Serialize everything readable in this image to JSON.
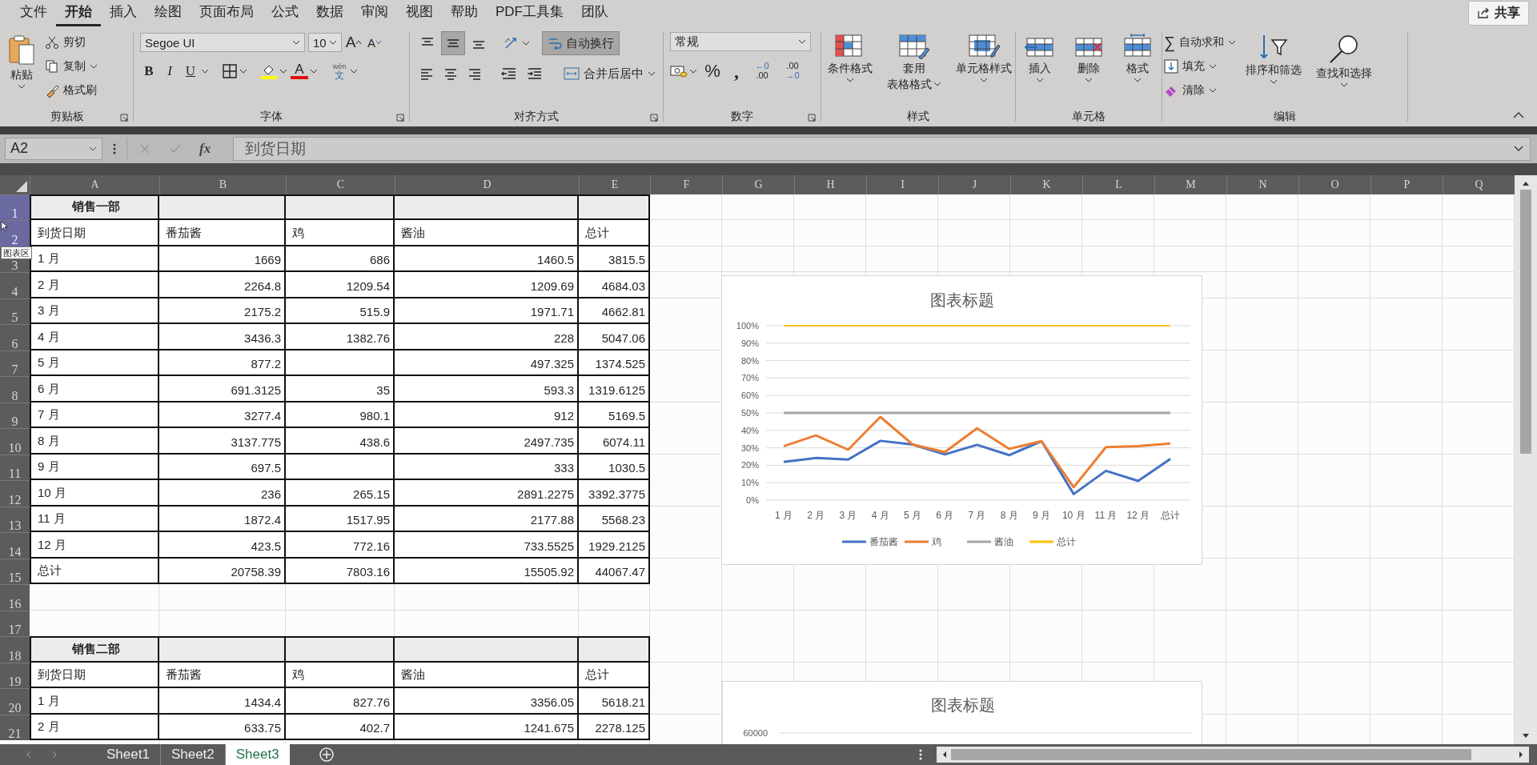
{
  "menu": {
    "tabs": [
      {
        "label": "文件",
        "selected": false
      },
      {
        "label": "开始",
        "selected": true
      },
      {
        "label": "插入",
        "selected": false
      },
      {
        "label": "绘图",
        "selected": false
      },
      {
        "label": "页面布局",
        "selected": false
      },
      {
        "label": "公式",
        "selected": false
      },
      {
        "label": "数据",
        "selected": false
      },
      {
        "label": "审阅",
        "selected": false
      },
      {
        "label": "视图",
        "selected": false
      },
      {
        "label": "帮助",
        "selected": false
      },
      {
        "label": "PDF工具集",
        "selected": false
      },
      {
        "label": "团队",
        "selected": false
      }
    ],
    "share": "共享"
  },
  "ribbon": {
    "clipboard": {
      "label": "剪贴板",
      "paste": "粘贴",
      "cut": "剪切",
      "copy": "复制",
      "format_painter": "格式刷"
    },
    "font": {
      "label": "字体",
      "family": "Segoe UI",
      "size": "10",
      "grow": "A",
      "shrink": "A",
      "styles": [
        {
          "kind": "bold",
          "label": "B"
        },
        {
          "kind": "italic",
          "label": "I"
        },
        {
          "kind": "underline",
          "label": "U"
        }
      ],
      "font_color": "A",
      "phonetic_top": "wén",
      "phonetic_char": "文"
    },
    "alignment": {
      "label": "对齐方式",
      "vertical": [
        {
          "kind": "top",
          "selected": false
        },
        {
          "kind": "middle",
          "selected": true
        },
        {
          "kind": "bottom",
          "selected": false
        }
      ],
      "wrap": {
        "label": "自动换行",
        "selected": true
      },
      "merge": "合并后居中"
    },
    "number": {
      "label": "数字",
      "format": "常规",
      "percent": "%",
      "comma": ",",
      "decimals": [
        {
          "kind": "increase",
          "top": "←0",
          "bottom": ".00"
        },
        {
          "kind": "decrease",
          "top": ".00",
          "bottom": "→0"
        }
      ]
    },
    "styles": {
      "label": "样式",
      "buttons": [
        {
          "kind": "conditional",
          "lines": [
            "条件格式"
          ]
        },
        {
          "kind": "table",
          "lines": [
            "套用",
            "表格格式"
          ]
        },
        {
          "kind": "cell",
          "lines": [
            "单元格样式"
          ]
        }
      ]
    },
    "cells": {
      "label": "单元格",
      "buttons": [
        {
          "kind": "insert",
          "label": "插入"
        },
        {
          "kind": "delete",
          "label": "删除"
        },
        {
          "kind": "format",
          "label": "格式"
        }
      ]
    },
    "editing": {
      "label": "编辑",
      "autosum_symbol": "∑",
      "autosum": "自动求和",
      "fill": "填充",
      "clear": "清除",
      "sort": "排序和筛选",
      "find": "查找和选择"
    }
  },
  "formula_bar": {
    "name_box": "A2",
    "fx": "fx",
    "value": "到货日期"
  },
  "sheet": {
    "columns": [
      "A",
      "B",
      "C",
      "D",
      "E",
      "F",
      "G",
      "H",
      "I",
      "J",
      "K",
      "L",
      "M",
      "N",
      "O",
      "P",
      "Q"
    ],
    "rows": [
      {
        "number": "1",
        "selected": true,
        "kind": "title",
        "cells": [
          "销售一部",
          null,
          null,
          null,
          null
        ]
      },
      {
        "number": "2",
        "selected": true,
        "kind": "header",
        "cells": [
          "到货日期",
          "番茄酱",
          "鸡",
          "酱油",
          "总计"
        ]
      },
      {
        "number": "3",
        "selected": false,
        "kind": "data",
        "cells": [
          "1 月",
          "1669",
          "686",
          "1460.5",
          "3815.5"
        ]
      },
      {
        "number": "4",
        "selected": false,
        "kind": "data",
        "cells": [
          "2 月",
          "2264.8",
          "1209.54",
          "1209.69",
          "4684.03"
        ]
      },
      {
        "number": "5",
        "selected": false,
        "kind": "data",
        "cells": [
          "3 月",
          "2175.2",
          "515.9",
          "1971.71",
          "4662.81"
        ]
      },
      {
        "number": "6",
        "selected": false,
        "kind": "data",
        "cells": [
          "4 月",
          "3436.3",
          "1382.76",
          "228",
          "5047.06"
        ]
      },
      {
        "number": "7",
        "selected": false,
        "kind": "data",
        "cells": [
          "5 月",
          "877.2",
          null,
          "497.325",
          "1374.525"
        ]
      },
      {
        "number": "8",
        "selected": false,
        "kind": "data",
        "cells": [
          "6 月",
          "691.3125",
          "35",
          "593.3",
          "1319.6125"
        ]
      },
      {
        "number": "9",
        "selected": false,
        "kind": "data",
        "cells": [
          "7 月",
          "3277.4",
          "980.1",
          "912",
          "5169.5"
        ]
      },
      {
        "number": "10",
        "selected": false,
        "kind": "data",
        "cells": [
          "8 月",
          "3137.775",
          "438.6",
          "2497.735",
          "6074.11"
        ]
      },
      {
        "number": "11",
        "selected": false,
        "kind": "data",
        "cells": [
          "9 月",
          "697.5",
          null,
          "333",
          "1030.5"
        ]
      },
      {
        "number": "12",
        "selected": false,
        "kind": "data",
        "cells": [
          "10 月",
          "236",
          "265.15",
          "2891.2275",
          "3392.3775"
        ]
      },
      {
        "number": "13",
        "selected": false,
        "kind": "data",
        "cells": [
          "11 月",
          "1872.4",
          "1517.95",
          "2177.88",
          "5568.23"
        ]
      },
      {
        "number": "14",
        "selected": false,
        "kind": "data",
        "cells": [
          "12 月",
          "423.5",
          "772.16",
          "733.5525",
          "1929.2125"
        ]
      },
      {
        "number": "15",
        "selected": false,
        "kind": "data",
        "cells": [
          "总计",
          "20758.39",
          "7803.16",
          "15505.92",
          "44067.47"
        ]
      },
      {
        "number": "16",
        "selected": false,
        "kind": "empty"
      },
      {
        "number": "17",
        "selected": false,
        "kind": "empty"
      },
      {
        "number": "18",
        "selected": false,
        "kind": "title",
        "cells": [
          "销售二部",
          null,
          null,
          null,
          null
        ]
      },
      {
        "number": "19",
        "selected": false,
        "kind": "header",
        "cells": [
          "到货日期",
          "番茄酱",
          "鸡",
          "酱油",
          "总计"
        ]
      },
      {
        "number": "20",
        "selected": false,
        "kind": "data",
        "cells": [
          "1 月",
          "1434.4",
          "827.76",
          "3356.05",
          "5618.21"
        ]
      },
      {
        "number": "21",
        "selected": false,
        "kind": "data",
        "cells": [
          "2 月",
          "633.75",
          "402.7",
          "1241.675",
          "2278.125"
        ]
      }
    ]
  },
  "tooltip": "图表区",
  "charts": [
    {
      "chart_data": {
        "type": "line",
        "title": "图表标题",
        "grid": true,
        "legend": true,
        "categories": [
          "1 月",
          "2 月",
          "3 月",
          "4 月",
          "5 月",
          "6 月",
          "7 月",
          "8 月",
          "9 月",
          "10 月",
          "11 月",
          "12 月",
          "总计"
        ],
        "ylim": [
          0,
          100
        ],
        "yticks": [
          {
            "value": 0,
            "label": "0%"
          },
          {
            "value": 10,
            "label": "10%"
          },
          {
            "value": 20,
            "label": "20%"
          },
          {
            "value": 30,
            "label": "30%"
          },
          {
            "value": 40,
            "label": "40%"
          },
          {
            "value": 50,
            "label": "50%"
          },
          {
            "value": 60,
            "label": "60%"
          },
          {
            "value": 70,
            "label": "70%"
          },
          {
            "value": 80,
            "label": "80%"
          },
          {
            "value": 90,
            "label": "90%"
          },
          {
            "value": 100,
            "label": "100%"
          }
        ],
        "series": [
          {
            "name": "番茄酱",
            "color": "#4472c4",
            "values": [
              21.9,
              24.2,
              23.3,
              34.0,
              31.9,
              26.2,
              31.7,
              25.8,
              33.8,
              3.5,
              16.8,
              11.0,
              23.6
            ]
          },
          {
            "name": "鸡",
            "color": "#ed7d31",
            "values": [
              30.9,
              37.1,
              28.9,
              47.7,
              31.9,
              27.5,
              41.2,
              29.4,
              33.8,
              7.4,
              30.4,
              31.0,
              32.4
            ]
          },
          {
            "name": "酱油",
            "color": "#a5a5a5",
            "values": [
              50,
              50,
              50,
              50,
              50,
              50,
              50,
              50,
              50,
              50,
              50,
              50,
              50
            ]
          },
          {
            "name": "总计",
            "color": "#ffc000",
            "values": [
              100,
              100,
              100,
              100,
              100,
              100,
              100,
              100,
              100,
              100,
              100,
              100,
              100
            ]
          }
        ]
      }
    },
    {
      "title": "图表标题",
      "axis_label": "60000"
    }
  ],
  "sheet_tabs": [
    {
      "label": "Sheet1",
      "selected": false
    },
    {
      "label": "Sheet2",
      "selected": false
    },
    {
      "label": "Sheet3",
      "selected": true
    }
  ]
}
